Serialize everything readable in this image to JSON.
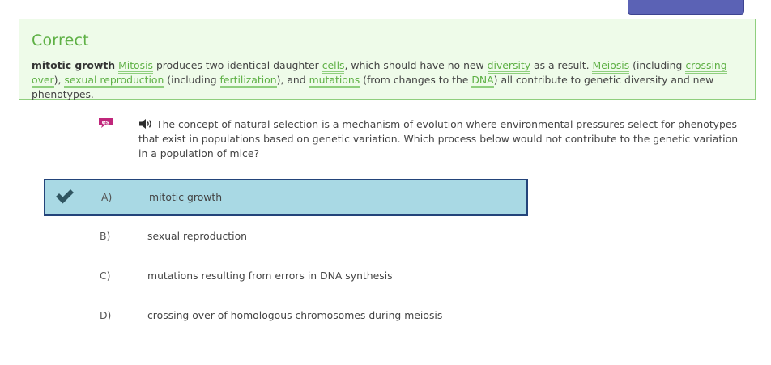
{
  "feedback": {
    "title": "Correct",
    "answer_label": "mitotic growth",
    "segments": [
      {
        "text": " "
      },
      {
        "text": "Mitosis",
        "link": true
      },
      {
        "text": " produces two identical daughter "
      },
      {
        "text": "cells",
        "link": true
      },
      {
        "text": ", which should have no new "
      },
      {
        "text": "diversity",
        "link": true
      },
      {
        "text": " as a result. "
      },
      {
        "text": "Meiosis",
        "link": true
      },
      {
        "text": " (including "
      },
      {
        "text": "crossing over",
        "link": true
      },
      {
        "text": "), "
      },
      {
        "text": "sexual reproduction",
        "link": true
      },
      {
        "text": " (including "
      },
      {
        "text": "fertilization",
        "link": true
      },
      {
        "text": "), and "
      },
      {
        "text": "mutations",
        "link": true
      },
      {
        "text": " (from changes to the "
      },
      {
        "text": "DNA",
        "link": true
      },
      {
        "text": ") all contribute to genetic diversity and new phenotypes."
      }
    ]
  },
  "question": {
    "text": "The concept of natural selection is a mechanism of evolution where environmental pressures select for phenotypes that exist in populations based on genetic variation. Which process below would not contribute to the genetic variation in a population of mice?"
  },
  "choices": [
    {
      "letter": "A)",
      "text": "mitotic growth",
      "selected": true
    },
    {
      "letter": "B)",
      "text": "sexual reproduction",
      "selected": false
    },
    {
      "letter": "C)",
      "text": "mutations resulting from errors in DNA synthesis",
      "selected": false
    },
    {
      "letter": "D)",
      "text": "crossing over of homologous chromosomes during meiosis",
      "selected": false
    }
  ],
  "icons": {
    "language": "spanish-translation-icon",
    "audio": "speaker-icon",
    "correct": "checkmark-icon"
  },
  "colors": {
    "correct_green": "#5eb045",
    "feedback_bg": "#eefbe9",
    "selected_bg": "#a9d9e4",
    "selected_border": "#23447a",
    "top_button": "#5b62b5",
    "lang_badge": "#c0267b"
  }
}
